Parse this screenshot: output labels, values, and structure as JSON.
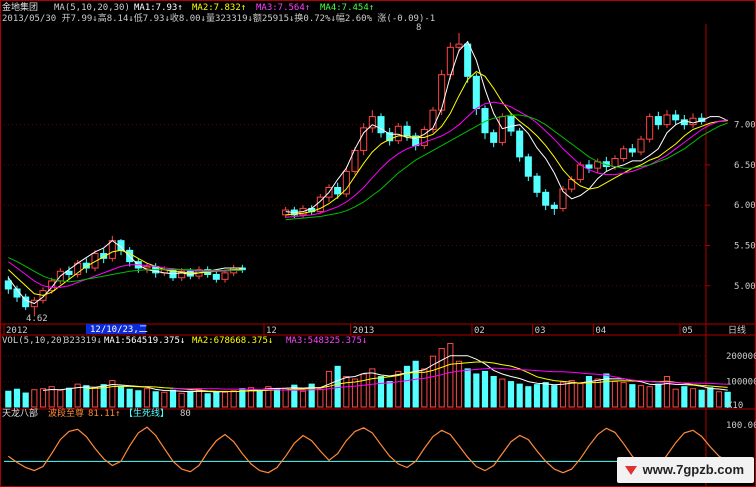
{
  "header": {
    "stock_name": "金地集团",
    "ma_label": "MA(5,10,20,30)",
    "ma1": "MA1:7.93↑",
    "ma2": "MA2:7.832↑",
    "ma3": "MA3:7.564↑",
    "ma4": "MA4:7.454↑",
    "line2": "2013/05/30 开7.99↓高8.14↓低7.93↓收8.00↓量323319↓额25915↓换0.72%↓幅2.60% 涨(-0.09)-1"
  },
  "vol_header": {
    "label": "VOL(5,10,20)",
    "v": "323319↓",
    "ma1": "MA1:564519.375↓",
    "ma2": "MA2:678668.375↓",
    "ma3": "MA3:548325.375↓"
  },
  "ind_header": {
    "name": "天龙八部",
    "wave": "波段至尊",
    "val": "81.11↑",
    "sh": "【生死线】",
    "n80": "80"
  },
  "labels": {
    "high_mark": "8",
    "low_mark": "4.62",
    "cursor_date": "12/10/23,二",
    "period": "日线",
    "vol_unit": "X10"
  },
  "watermark": "www.7gpzb.com",
  "colors": {
    "up": "#ff4646",
    "down": "#54ffff",
    "ma1": "#ffffff",
    "ma2": "#ffff00",
    "ma3": "#ff00ff",
    "ma4": "#00c000",
    "axis": "#b00000",
    "grid": "#600000"
  },
  "chart_data": [
    {
      "type": "candlestick",
      "title": "金地集团",
      "y_ticks": [
        "7.00",
        "6.50",
        "6.00",
        "5.50",
        "5.00"
      ],
      "ylim": [
        4.55,
        8.2
      ],
      "x_ticks": [
        "2012",
        "10",
        "12",
        "2013",
        "02",
        "03",
        "04",
        "05"
      ],
      "series": [
        {
          "name": "MA1",
          "values": [
            5.1,
            4.95,
            4.82,
            4.78,
            4.86,
            4.98,
            5.12,
            5.2,
            5.28,
            5.35,
            5.42,
            5.47,
            5.56,
            5.48,
            5.36,
            5.26,
            5.2,
            5.18,
            5.16,
            5.15,
            5.16,
            5.14,
            5.16,
            5.18,
            5.2,
            5.22,
            5.22,
            5.22,
            null,
            null,
            null,
            null,
            5.92,
            5.91,
            5.92,
            5.96,
            6.05,
            6.16,
            6.32,
            6.46,
            6.7,
            6.9,
            7.0,
            6.95,
            6.88,
            6.88,
            6.84,
            6.83,
            6.88,
            6.96,
            7.2,
            7.6,
            7.92,
            8.03,
            7.8,
            7.44,
            7.14,
            6.95,
            6.98,
            7.0,
            6.89,
            6.71,
            6.58,
            6.4,
            6.17,
            6.08,
            6.12,
            6.2,
            6.33,
            6.42,
            6.47,
            6.5,
            6.55,
            6.55,
            6.62,
            6.7,
            6.9,
            7.0,
            7.05,
            7.02,
            7.05,
            7.1,
            7.1,
            7.05
          ]
        },
        {
          "name": "MA2",
          "values": [
            5.2,
            5.1,
            5.0,
            4.9,
            4.88,
            4.92,
            5.0,
            5.08,
            5.16,
            5.24,
            5.3,
            5.36,
            5.42,
            5.44,
            5.4,
            5.34,
            5.28,
            5.24,
            5.2,
            5.18,
            5.17,
            5.16,
            5.16,
            5.17,
            5.18,
            5.19,
            5.2,
            5.2,
            null,
            null,
            null,
            null,
            5.88,
            5.89,
            5.9,
            5.92,
            5.96,
            6.02,
            6.1,
            6.2,
            6.36,
            6.52,
            6.66,
            6.76,
            6.82,
            6.86,
            6.86,
            6.84,
            6.84,
            6.88,
            6.98,
            7.14,
            7.36,
            7.56,
            7.66,
            7.6,
            7.45,
            7.28,
            7.14,
            7.04,
            6.96,
            6.86,
            6.74,
            6.6,
            6.44,
            6.32,
            6.24,
            6.2,
            6.22,
            6.28,
            6.34,
            6.4,
            6.46,
            6.5,
            6.56,
            6.6,
            6.68,
            6.76,
            6.86,
            6.94,
            6.98,
            7.02,
            7.04,
            7.05
          ]
        },
        {
          "name": "MA3",
          "values": [
            5.3,
            5.22,
            5.14,
            5.06,
            5.0,
            4.98,
            4.98,
            5.0,
            5.04,
            5.08,
            5.12,
            5.16,
            5.2,
            5.24,
            5.26,
            5.26,
            5.25,
            5.24,
            5.22,
            5.21,
            5.2,
            5.19,
            5.18,
            5.18,
            5.18,
            5.18,
            5.19,
            5.19,
            null,
            null,
            null,
            null,
            5.85,
            5.86,
            5.87,
            5.88,
            5.9,
            5.94,
            5.98,
            6.04,
            6.12,
            6.22,
            6.34,
            6.46,
            6.56,
            6.64,
            6.7,
            6.74,
            6.78,
            6.82,
            6.86,
            6.92,
            7.0,
            7.1,
            7.2,
            7.26,
            7.28,
            7.26,
            7.22,
            7.16,
            7.1,
            7.02,
            6.92,
            6.82,
            6.7,
            6.6,
            6.5,
            6.44,
            6.4,
            6.38,
            6.38,
            6.4,
            6.42,
            6.46,
            6.5,
            6.56,
            6.62,
            6.7,
            6.78,
            6.86,
            6.94,
            7.0,
            7.04,
            7.06
          ]
        },
        {
          "name": "MA4",
          "values": [
            5.35,
            5.3,
            5.24,
            5.18,
            5.12,
            5.08,
            5.06,
            5.05,
            5.06,
            5.08,
            5.1,
            5.12,
            5.14,
            5.16,
            5.18,
            5.19,
            5.2,
            5.2,
            5.2,
            5.2,
            5.2,
            5.2,
            5.19,
            5.19,
            5.19,
            5.19,
            5.19,
            5.19,
            null,
            null,
            null,
            null,
            5.82,
            5.83,
            5.84,
            5.85,
            5.86,
            5.88,
            5.9,
            5.93,
            5.98,
            6.04,
            6.12,
            6.2,
            6.3,
            6.4,
            6.48,
            6.56,
            6.62,
            6.68,
            6.74,
            6.8,
            6.86,
            6.92,
            6.98,
            7.04,
            7.08,
            7.1,
            7.12,
            7.12,
            7.1,
            7.06,
            7.0,
            6.92,
            6.84,
            6.76,
            6.68,
            6.6,
            6.54,
            6.5,
            6.48,
            6.46,
            6.46,
            6.48,
            6.5,
            6.54,
            6.58,
            6.64,
            6.7,
            6.78,
            6.86,
            6.92,
            6.98,
            7.02
          ]
        }
      ],
      "candles": [
        [
          5.06,
          4.96,
          5.12,
          4.9
        ],
        [
          4.96,
          4.86,
          5.0,
          4.8
        ],
        [
          4.86,
          4.74,
          4.9,
          4.7
        ],
        [
          4.74,
          4.82,
          4.86,
          4.62
        ],
        [
          4.82,
          4.94,
          4.98,
          4.78
        ],
        [
          4.94,
          5.06,
          5.1,
          4.9
        ],
        [
          5.06,
          5.18,
          5.22,
          5.02
        ],
        [
          5.18,
          5.14,
          5.24,
          5.08
        ],
        [
          5.14,
          5.28,
          5.32,
          5.1
        ],
        [
          5.28,
          5.22,
          5.34,
          5.16
        ],
        [
          5.22,
          5.4,
          5.44,
          5.18
        ],
        [
          5.4,
          5.34,
          5.46,
          5.28
        ],
        [
          5.34,
          5.56,
          5.62,
          5.3
        ],
        [
          5.56,
          5.44,
          5.58,
          5.38
        ],
        [
          5.44,
          5.3,
          5.48,
          5.24
        ],
        [
          5.3,
          5.22,
          5.34,
          5.16
        ],
        [
          5.22,
          5.24,
          5.28,
          5.16
        ],
        [
          5.24,
          5.16,
          5.28,
          5.1
        ],
        [
          5.16,
          5.2,
          5.24,
          5.12
        ],
        [
          5.2,
          5.1,
          5.22,
          5.06
        ],
        [
          5.1,
          5.18,
          5.22,
          5.06
        ],
        [
          5.18,
          5.12,
          5.22,
          5.08
        ],
        [
          5.12,
          5.2,
          5.24,
          5.08
        ],
        [
          5.2,
          5.14,
          5.24,
          5.1
        ],
        [
          5.14,
          5.08,
          5.18,
          5.04
        ],
        [
          5.08,
          5.16,
          5.2,
          5.04
        ],
        [
          5.16,
          5.22,
          5.26,
          5.12
        ],
        [
          5.22,
          5.2,
          5.26,
          5.16
        ],
        null,
        null,
        null,
        null,
        [
          5.88,
          5.94,
          5.98,
          5.84
        ],
        [
          5.94,
          5.88,
          5.98,
          5.84
        ],
        [
          5.88,
          5.96,
          6.0,
          5.84
        ],
        [
          5.96,
          5.92,
          6.0,
          5.88
        ],
        [
          5.92,
          6.1,
          6.14,
          5.9
        ],
        [
          6.1,
          6.22,
          6.26,
          6.04
        ],
        [
          6.22,
          6.14,
          6.28,
          6.08
        ],
        [
          6.14,
          6.42,
          6.48,
          6.1
        ],
        [
          6.42,
          6.68,
          6.72,
          6.38
        ],
        [
          6.68,
          6.96,
          7.02,
          6.62
        ],
        [
          6.96,
          7.1,
          7.18,
          6.9
        ],
        [
          7.1,
          6.9,
          7.14,
          6.84
        ],
        [
          6.9,
          6.8,
          6.96,
          6.74
        ],
        [
          6.8,
          6.98,
          7.02,
          6.76
        ],
        [
          6.98,
          6.86,
          7.04,
          6.8
        ],
        [
          6.86,
          6.74,
          6.9,
          6.68
        ],
        [
          6.74,
          6.94,
          6.98,
          6.7
        ],
        [
          6.94,
          7.18,
          7.22,
          6.9
        ],
        [
          7.18,
          7.62,
          7.68,
          7.12
        ],
        [
          7.62,
          7.96,
          8.02,
          7.56
        ],
        [
          7.96,
          8.0,
          8.14,
          7.9
        ],
        [
          8.0,
          7.6,
          8.04,
          7.52
        ],
        [
          7.6,
          7.2,
          7.64,
          7.12
        ],
        [
          7.2,
          6.9,
          7.24,
          6.82
        ],
        [
          6.9,
          6.78,
          6.94,
          6.72
        ],
        [
          6.78,
          7.1,
          7.14,
          6.74
        ],
        [
          7.1,
          6.92,
          7.14,
          6.86
        ],
        [
          6.92,
          6.6,
          6.96,
          6.54
        ],
        [
          6.6,
          6.36,
          6.64,
          6.3
        ],
        [
          6.36,
          6.16,
          6.4,
          6.1
        ],
        [
          6.16,
          6.0,
          6.2,
          5.94
        ],
        [
          6.0,
          5.96,
          6.04,
          5.88
        ],
        [
          5.96,
          6.2,
          6.24,
          5.92
        ],
        [
          6.2,
          6.32,
          6.36,
          6.16
        ],
        [
          6.32,
          6.5,
          6.54,
          6.28
        ],
        [
          6.5,
          6.46,
          6.56,
          6.4
        ],
        [
          6.46,
          6.54,
          6.58,
          6.4
        ],
        [
          6.54,
          6.48,
          6.6,
          6.42
        ],
        [
          6.48,
          6.58,
          6.62,
          6.44
        ],
        [
          6.58,
          6.7,
          6.74,
          6.54
        ],
        [
          6.7,
          6.66,
          6.76,
          6.6
        ],
        [
          6.66,
          6.82,
          6.86,
          6.62
        ],
        [
          6.82,
          7.1,
          7.14,
          6.78
        ],
        [
          7.1,
          7.0,
          7.16,
          6.94
        ],
        [
          7.0,
          7.12,
          7.18,
          6.96
        ],
        [
          7.12,
          7.06,
          7.18,
          7.0
        ],
        [
          7.06,
          7.0,
          7.12,
          6.94
        ],
        [
          7.0,
          7.08,
          7.14,
          6.96
        ],
        [
          7.08,
          7.04,
          7.14,
          7.0
        ]
      ]
    },
    {
      "type": "bar",
      "title": "VOL(5,10,20)",
      "y_ticks": [
        "200000",
        "100000"
      ],
      "ylim": [
        0,
        240000
      ],
      "values": [
        62000,
        70000,
        55000,
        68000,
        72000,
        80000,
        66000,
        74000,
        90000,
        84000,
        76000,
        88000,
        104000,
        80000,
        70000,
        64000,
        72000,
        60000,
        58000,
        66000,
        54000,
        62000,
        70000,
        52000,
        60000,
        58000,
        64000,
        72000,
        76000,
        68000,
        80000,
        70000,
        74000,
        86000,
        62000,
        90000,
        70000,
        140000,
        160000,
        120000,
        110000,
        130000,
        150000,
        120000,
        100000,
        140000,
        160000,
        180000,
        150000,
        200000,
        230000,
        250000,
        180000,
        150000,
        130000,
        140000,
        120000,
        110000,
        100000,
        90000,
        80000,
        88000,
        96000,
        84000,
        98000,
        104000,
        92000,
        120000,
        110000,
        130000,
        100000,
        96000,
        88000,
        84000,
        80000,
        90000,
        120000,
        70000,
        80000,
        72000,
        66000,
        76000,
        60000,
        58000
      ],
      "up": [
        0,
        0,
        0,
        1,
        1,
        1,
        1,
        0,
        1,
        0,
        1,
        0,
        1,
        0,
        0,
        0,
        1,
        0,
        1,
        0,
        1,
        0,
        1,
        0,
        0,
        1,
        1,
        0,
        1,
        0,
        1,
        0,
        1,
        0,
        1,
        0,
        1,
        1,
        0,
        1,
        1,
        1,
        1,
        0,
        0,
        1,
        0,
        0,
        1,
        1,
        1,
        1,
        1,
        0,
        0,
        0,
        0,
        1,
        0,
        0,
        0,
        0,
        0,
        0,
        1,
        1,
        1,
        0,
        1,
        0,
        1,
        1,
        0,
        1,
        1,
        0,
        1,
        1,
        0,
        1,
        0,
        0,
        1,
        0
      ]
    },
    {
      "type": "line",
      "title": "天龙八部",
      "y_ticks": [
        "100.00"
      ],
      "ylim": [
        -10,
        110
      ],
      "threshold": 30,
      "series": [
        {
          "name": "波段至尊",
          "values": [
            40,
            28,
            18,
            12,
            20,
            45,
            72,
            88,
            92,
            78,
            55,
            35,
            22,
            30,
            60,
            85,
            96,
            80,
            55,
            30,
            15,
            10,
            22,
            48,
            70,
            82,
            68,
            45,
            25,
            12,
            8,
            18,
            40,
            65,
            80,
            70,
            50,
            32,
            45,
            70,
            88,
            95,
            85,
            62,
            40,
            25,
            18,
            30,
            55,
            78,
            90,
            82,
            60,
            38,
            20,
            12,
            22,
            45,
            68,
            80,
            72,
            50,
            30,
            15,
            8,
            15,
            35,
            60,
            82,
            94,
            86,
            64,
            40,
            22,
            14,
            20,
            42,
            66,
            85,
            90,
            78,
            58,
            40,
            30
          ]
        }
      ]
    }
  ]
}
